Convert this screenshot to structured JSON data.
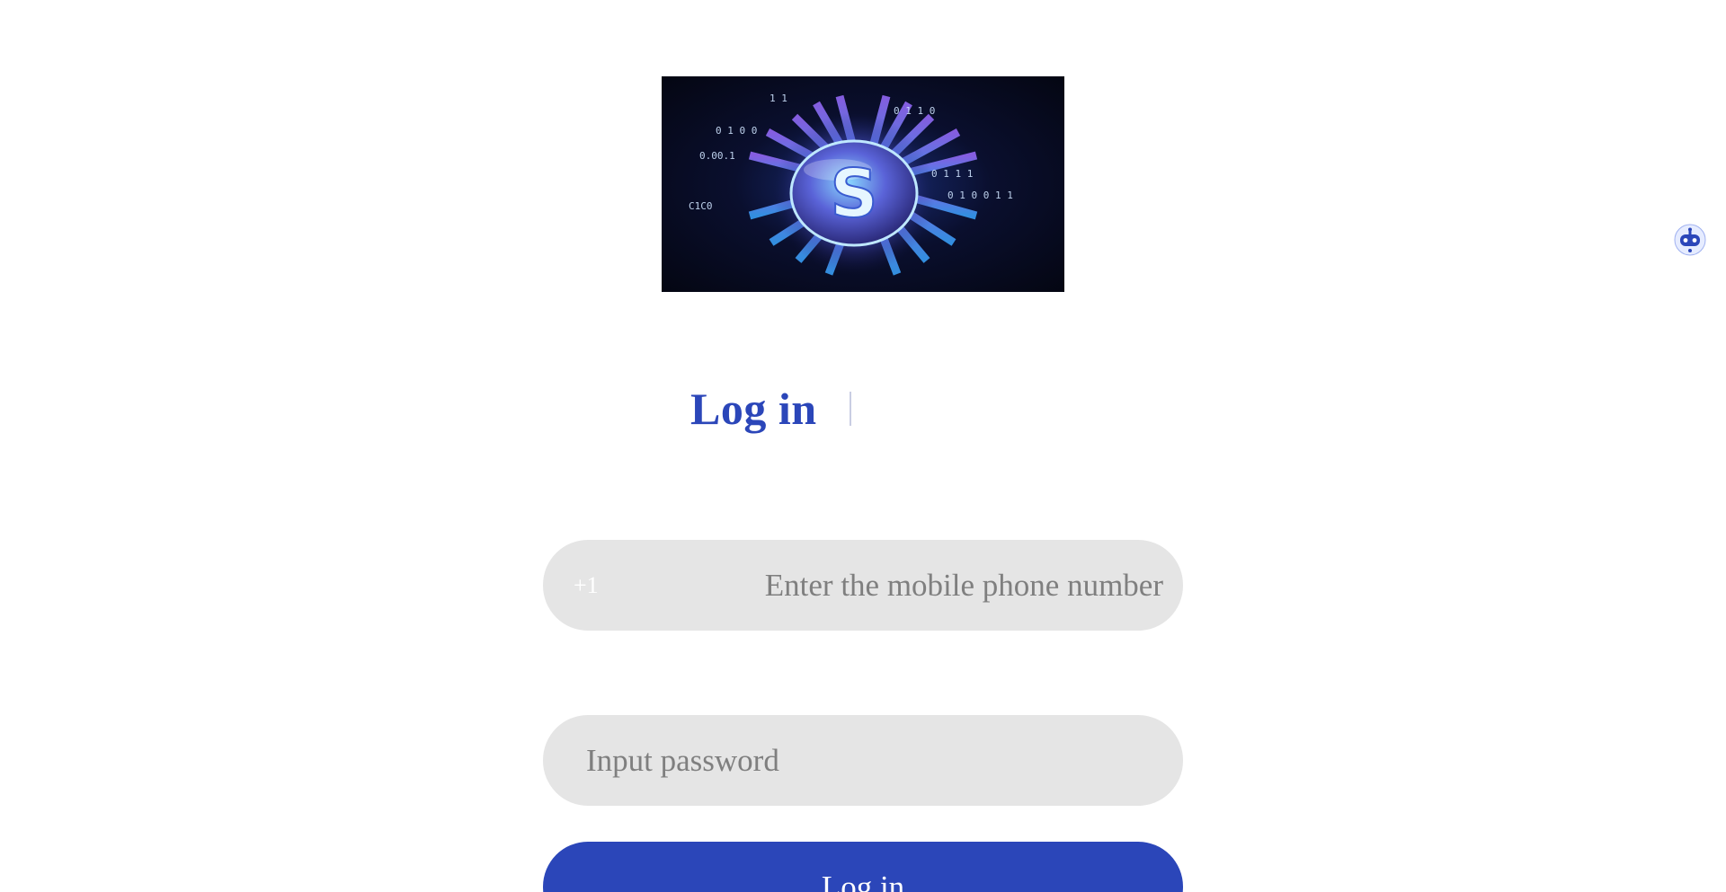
{
  "logo": {
    "letter": "S",
    "alt": "site-logo"
  },
  "tabs": {
    "login_label": "Log in"
  },
  "phone_field": {
    "country_code": "+1",
    "placeholder": "Enter the mobile phone number",
    "value": ""
  },
  "password_field": {
    "placeholder": "Input password",
    "value": ""
  },
  "submit": {
    "label": "Log in"
  },
  "colors": {
    "primary": "#2b46b9",
    "field_bg": "#e5e5e5",
    "placeholder": "#7f7f7f",
    "background": "#ffffff"
  },
  "icons": {
    "bot": "robot-assistant-icon"
  }
}
